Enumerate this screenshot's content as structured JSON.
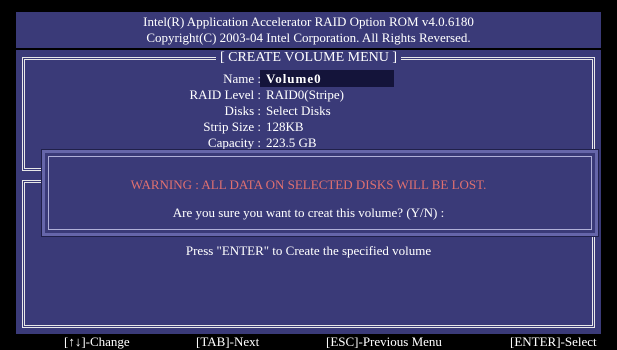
{
  "header": {
    "line1": "Intel(R) Application Accelerator RAID Option ROM v4.0.6180",
    "line2": "Copyright(C) 2003-04 Intel Corporation.  All Rights Reversed."
  },
  "menu": {
    "title": "[ CREATE VOLUME MENU ]"
  },
  "form": {
    "name_label": "Name :",
    "name_value": "Volume0",
    "raid_label": "RAID Level :",
    "raid_value": "RAID0(Stripe)",
    "disks_label": "Disks :",
    "disks_value": "Select Disks",
    "strip_label": "Strip Size :",
    "strip_value": "128KB",
    "capacity_label": "Capacity :",
    "capacity_value": "223.5 GB"
  },
  "dialog": {
    "warning": "WARNING : ALL DATA ON SELECTED DISKS WILL BE LOST.",
    "question": "Are you sure you want to creat this volume? (Y/N) :"
  },
  "help": {
    "text": "Press \"ENTER\" to Create the specified volume"
  },
  "footer": {
    "change": "[↑↓]-Change",
    "next": "[TAB]-Next",
    "previous": "[ESC]-Previous Menu",
    "select": "[ENTER]-Select"
  },
  "colors": {
    "background": "#3a3a78",
    "warning": "#e07070"
  }
}
